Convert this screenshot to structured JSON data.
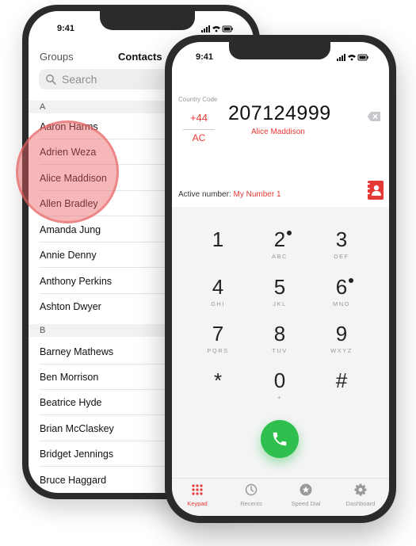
{
  "contacts_screen": {
    "status_time": "9:41",
    "groups_label": "Groups",
    "title": "Contacts",
    "search_placeholder": "Search",
    "sections": [
      {
        "letter": "A",
        "contacts": [
          "Aaron Harms",
          "Adrien Weza",
          "Alice Maddison",
          "Allen Bradley",
          "Amanda Jung",
          "Annie Denny",
          "Anthony Perkins",
          "Ashton Dwyer"
        ]
      },
      {
        "letter": "B",
        "contacts": [
          "Barney Mathews",
          "Ben Morrison",
          "Beatrice Hyde",
          "Brian McClaskey",
          "Bridget Jennings",
          "Bruce Haggard"
        ]
      }
    ]
  },
  "dialer_screen": {
    "status_time": "9:41",
    "country_code_label": "Country Code",
    "country_code": "+44",
    "country_abbr": "AC",
    "dialed_number": "207124999",
    "matched_contact": "Alice Maddison",
    "active_number_label": "Active number:",
    "active_number_value": "My Number 1",
    "keypad": [
      {
        "digit": "1",
        "letters": ""
      },
      {
        "digit": "2",
        "letters": "ABC"
      },
      {
        "digit": "3",
        "letters": "DEF"
      },
      {
        "digit": "4",
        "letters": "GHI"
      },
      {
        "digit": "5",
        "letters": "JKL"
      },
      {
        "digit": "6",
        "letters": "MNO"
      },
      {
        "digit": "7",
        "letters": "PQRS"
      },
      {
        "digit": "8",
        "letters": "TUV"
      },
      {
        "digit": "9",
        "letters": "WXYZ"
      },
      {
        "digit": "*",
        "letters": ""
      },
      {
        "digit": "0",
        "letters": "+"
      },
      {
        "digit": "#",
        "letters": ""
      }
    ],
    "tabs": [
      {
        "label": "Keypad",
        "icon": "keypad-icon",
        "active": true
      },
      {
        "label": "Recents",
        "icon": "clock-icon",
        "active": false
      },
      {
        "label": "Speed Dial",
        "icon": "star-icon",
        "active": false
      },
      {
        "label": "Dashboard",
        "icon": "gear-icon",
        "active": false
      }
    ],
    "colors": {
      "accent": "#e53935",
      "call_button": "#2fbf4e"
    }
  }
}
